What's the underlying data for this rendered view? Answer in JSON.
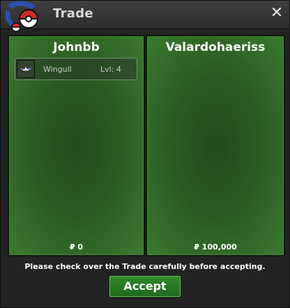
{
  "window": {
    "title": "Trade",
    "close_symbol": "✕"
  },
  "left_panel": {
    "player_name": "Johnbb",
    "items": [
      {
        "name": "Wingull",
        "level": "Lvl: 4",
        "icon": "wingull-icon"
      }
    ],
    "money": "₽ 0"
  },
  "right_panel": {
    "player_name": "Valardohaeriss",
    "items": [],
    "money": "₽ 100,000"
  },
  "notice": "Please check over the Trade carefully before accepting.",
  "accept_label": "Accept",
  "colors": {
    "panel_green": "#2a5a22",
    "button_green": "#2f8a2a",
    "titlebar": "#3a3a3a"
  }
}
